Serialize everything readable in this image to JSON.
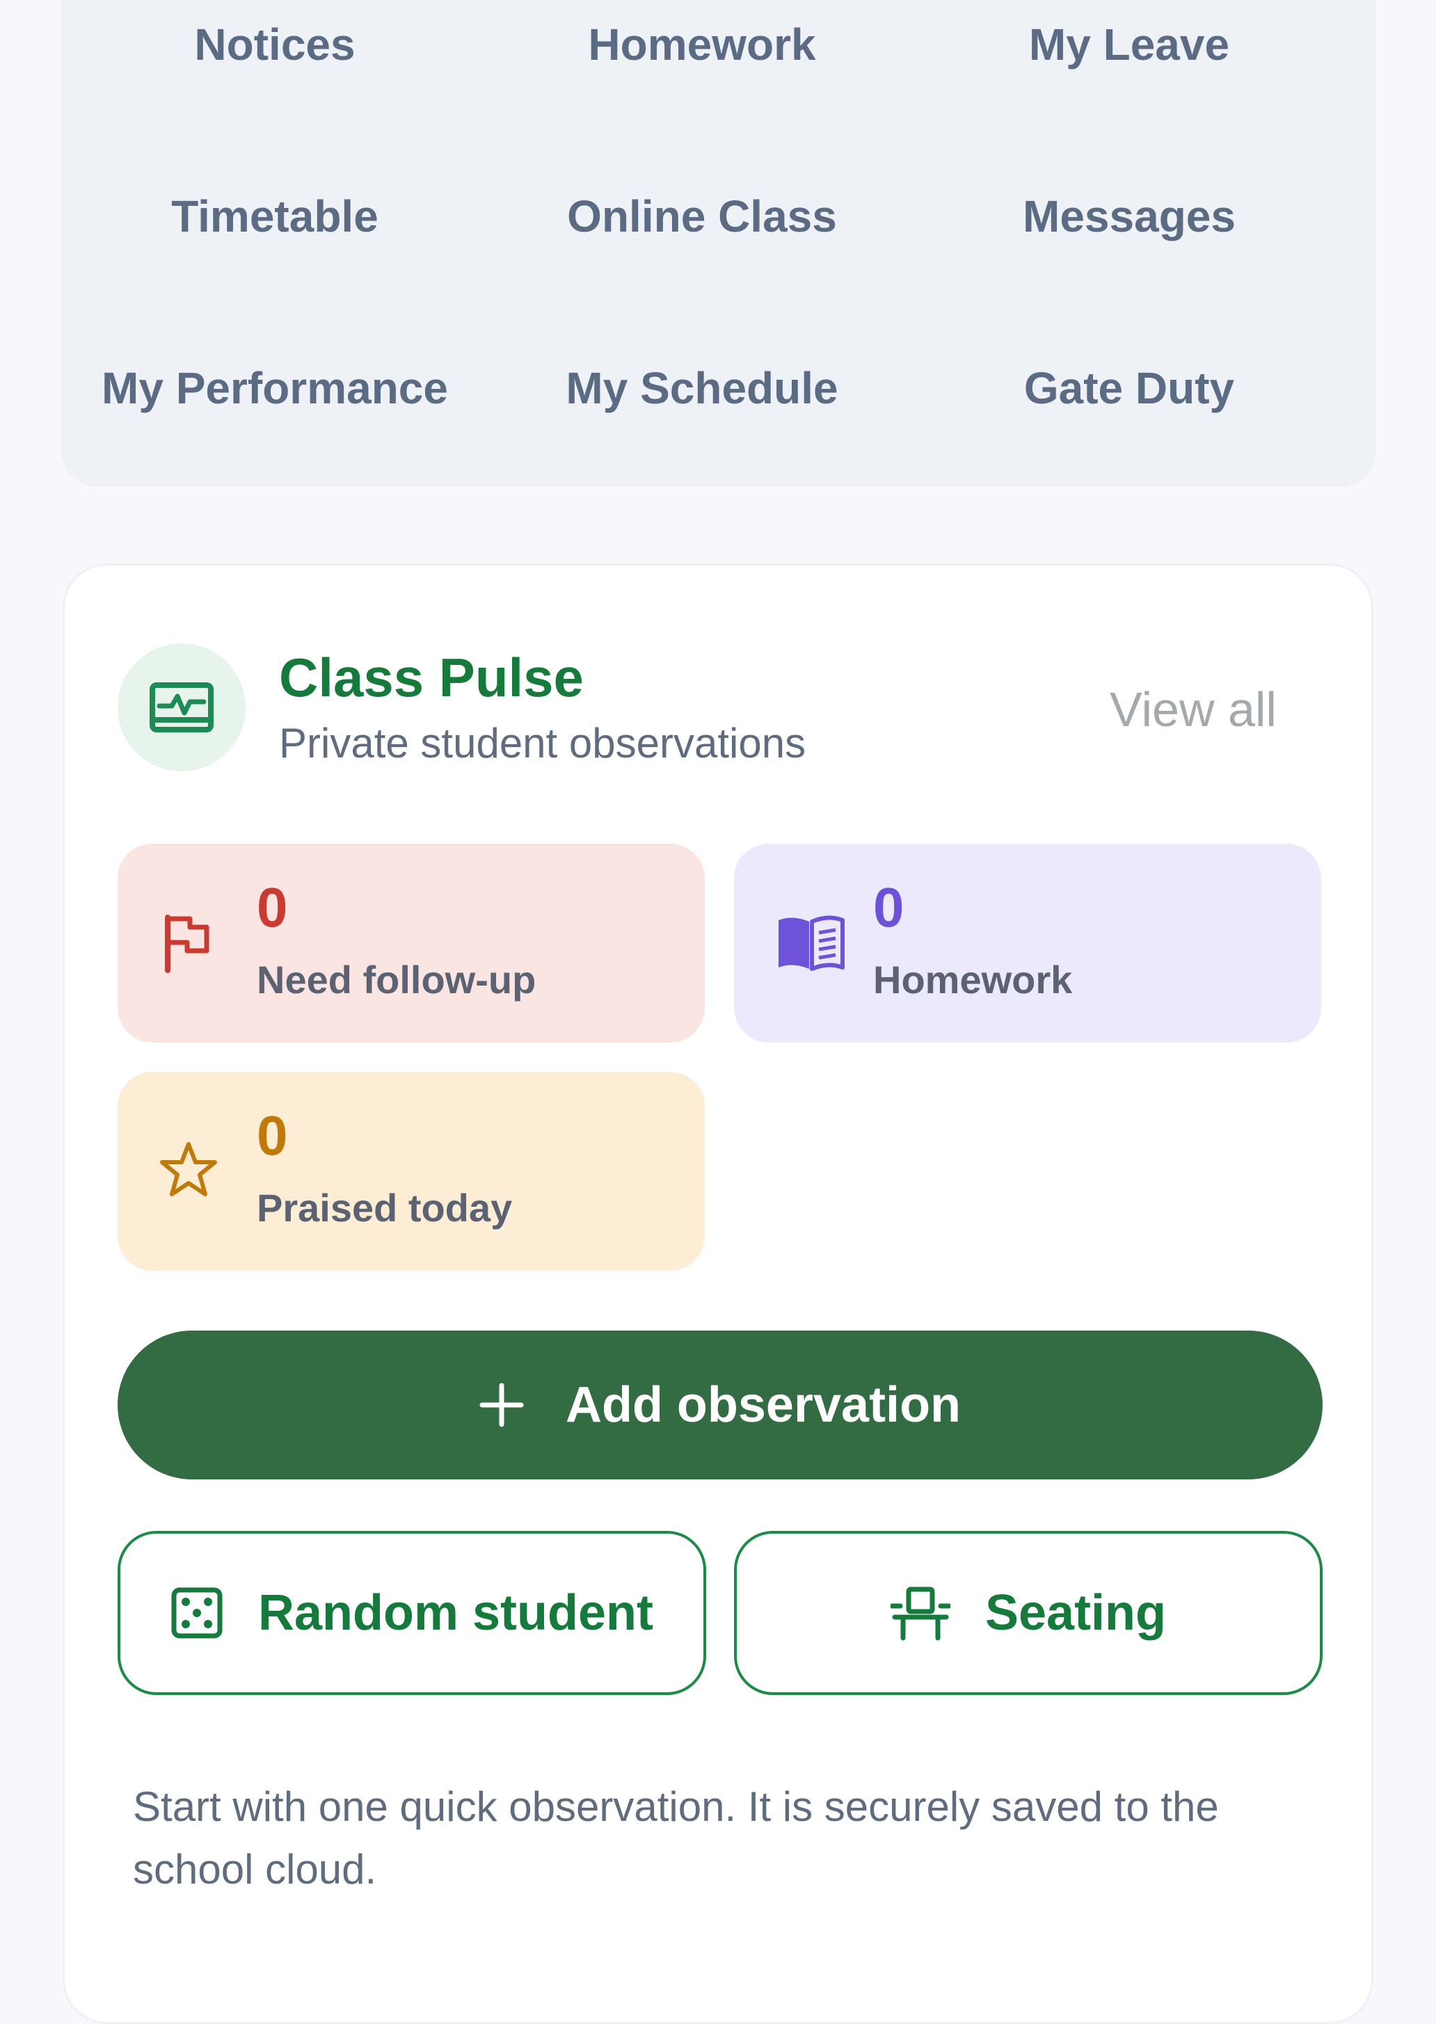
{
  "quick_links": {
    "items": [
      {
        "label": "Notices"
      },
      {
        "label": "Homework"
      },
      {
        "label": "My Leave"
      },
      {
        "label": "Timetable"
      },
      {
        "label": "Online Class"
      },
      {
        "label": "Messages"
      },
      {
        "label": "My Performance"
      },
      {
        "label": "My Schedule"
      },
      {
        "label": "Gate Duty"
      }
    ]
  },
  "class_pulse": {
    "title": "Class Pulse",
    "subtitle": "Private student observations",
    "view_all_label": "View all",
    "icon": "pulse-monitor-icon",
    "stats": {
      "follow_up": {
        "value": "0",
        "label": "Need follow-up",
        "icon": "flag-icon",
        "color": "#c93b30"
      },
      "homework": {
        "value": "0",
        "label": "Homework",
        "icon": "book-icon",
        "color": "#6d52d8"
      },
      "praised": {
        "value": "0",
        "label": "Praised today",
        "icon": "star-icon",
        "color": "#c07a0c"
      }
    },
    "add_observation_label": "Add observation",
    "random_student_label": "Random student",
    "seating_label": "Seating",
    "hint": "Start with one quick observation. It is securely saved to the school cloud."
  },
  "colors": {
    "brand_green": "#157a3c",
    "primary_button": "#336b43",
    "page_background": "#f6f8fb"
  }
}
